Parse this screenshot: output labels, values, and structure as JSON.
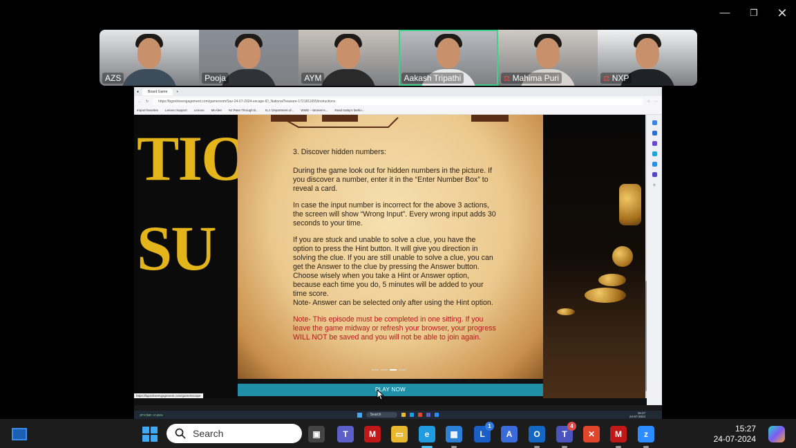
{
  "window": {
    "minimize_icon": "minimize-icon",
    "restore_icon": "restore-icon",
    "close_icon": "close-icon"
  },
  "participants": [
    {
      "name": "AZS",
      "mic_muted": false,
      "active": false,
      "bg": "#e4e6e8",
      "shirt": "#3d4c5a"
    },
    {
      "name": "Pooja",
      "mic_muted": false,
      "active": false,
      "bg": "#8a8f98",
      "shirt": "#2f3236"
    },
    {
      "name": "AYM",
      "mic_muted": false,
      "active": false,
      "bg": "#c8c2bb",
      "shirt": "#2a2a2a"
    },
    {
      "name": "Aakash Tripathi",
      "mic_muted": false,
      "active": true,
      "bg": "#b9bec3",
      "shirt": "#e8e8e8"
    },
    {
      "name": "Mahima Puri",
      "mic_muted": true,
      "active": false,
      "bg": "#cfcac4",
      "shirt": "#d7d3cf"
    },
    {
      "name": "NXP",
      "mic_muted": true,
      "active": false,
      "bg": "#f0f1f2",
      "shirt": "#1f2226"
    }
  ],
  "shared_screen": {
    "tab_title": "Board Game",
    "url": "https://bgonlineengagement.com/gameroom/Sav-24-07-2024-escape-ID_NationalTreasure-1721811655/instructions",
    "bookmarks": [
      "Import favorites",
      "Lenovo Support",
      "Lenovo",
      "McAfee",
      "NJ Pass-Through B...",
      "N.J. Department of...",
      "WWD – Women's...",
      "Read today's fashio..."
    ],
    "bg_letters_top": "TIO",
    "bg_letters_bottom": "SU",
    "instructions": {
      "heading": "3. Discover hidden numbers:",
      "para1": "During the game look out for hidden numbers in the picture. If you discover a number, enter it in the “Enter Number Box” to reveal a card.",
      "para2": "In case the input number is incorrect for the above 3 actions, the screen will show “Wrong Input”. Every wrong input adds 30 seconds to your time.",
      "para3": "If you are stuck and unable to solve a clue, you have the option to press the Hint button. It will give you direction in solving the clue. If you are still unable to solve a clue, you can get the Answer to the clue by pressing the Answer button. Choose wisely when you take a Hint or Answer option, because each time you do, 5 minutes will be added to your time score.",
      "para3_note": "Note- Answer can be selected only after using the Hint option.",
      "red_note": "Note- This episode must be completed in one sitting. If you leave the game midway or refresh your browser, your progress WILL NOT be saved and you will not be able to join again."
    },
    "play_button": "PLAY NOW",
    "status_url": "https://bgonlineengagement.com/game/escape",
    "inner_taskbar_search": "Search",
    "inner_taskbar_weather": "JPY/INR",
    "inner_taskbar_weather_change": "+0.65%",
    "inner_clock_time": "15:27",
    "inner_clock_date": "24-07-2024"
  },
  "taskbar": {
    "search_placeholder": "Search",
    "apps": [
      {
        "name": "task-view-icon",
        "color": "#444"
      },
      {
        "name": "teams-icon",
        "color": "#5b5fc7"
      },
      {
        "name": "mcafee-icon",
        "color": "#c01818"
      },
      {
        "name": "file-explorer-icon",
        "color": "#e8b930"
      },
      {
        "name": "edge-icon",
        "color": "#1f9be0"
      },
      {
        "name": "store-icon",
        "color": "#2e7fd6"
      },
      {
        "name": "lenovo-l-icon",
        "color": "#1a5fc8",
        "badge": "1"
      },
      {
        "name": "app-a-icon",
        "color": "#3b6bd8"
      },
      {
        "name": "outlook-icon",
        "color": "#1468c4"
      },
      {
        "name": "teams-new-icon",
        "color": "#4b53bc",
        "badge": "4"
      },
      {
        "name": "tool-icon",
        "color": "#e0462c"
      },
      {
        "name": "mcafee-shield-icon",
        "color": "#c01818"
      },
      {
        "name": "zoom-icon",
        "color": "#2d8cff"
      }
    ],
    "time": "15:27",
    "date": "24-07-2024"
  }
}
